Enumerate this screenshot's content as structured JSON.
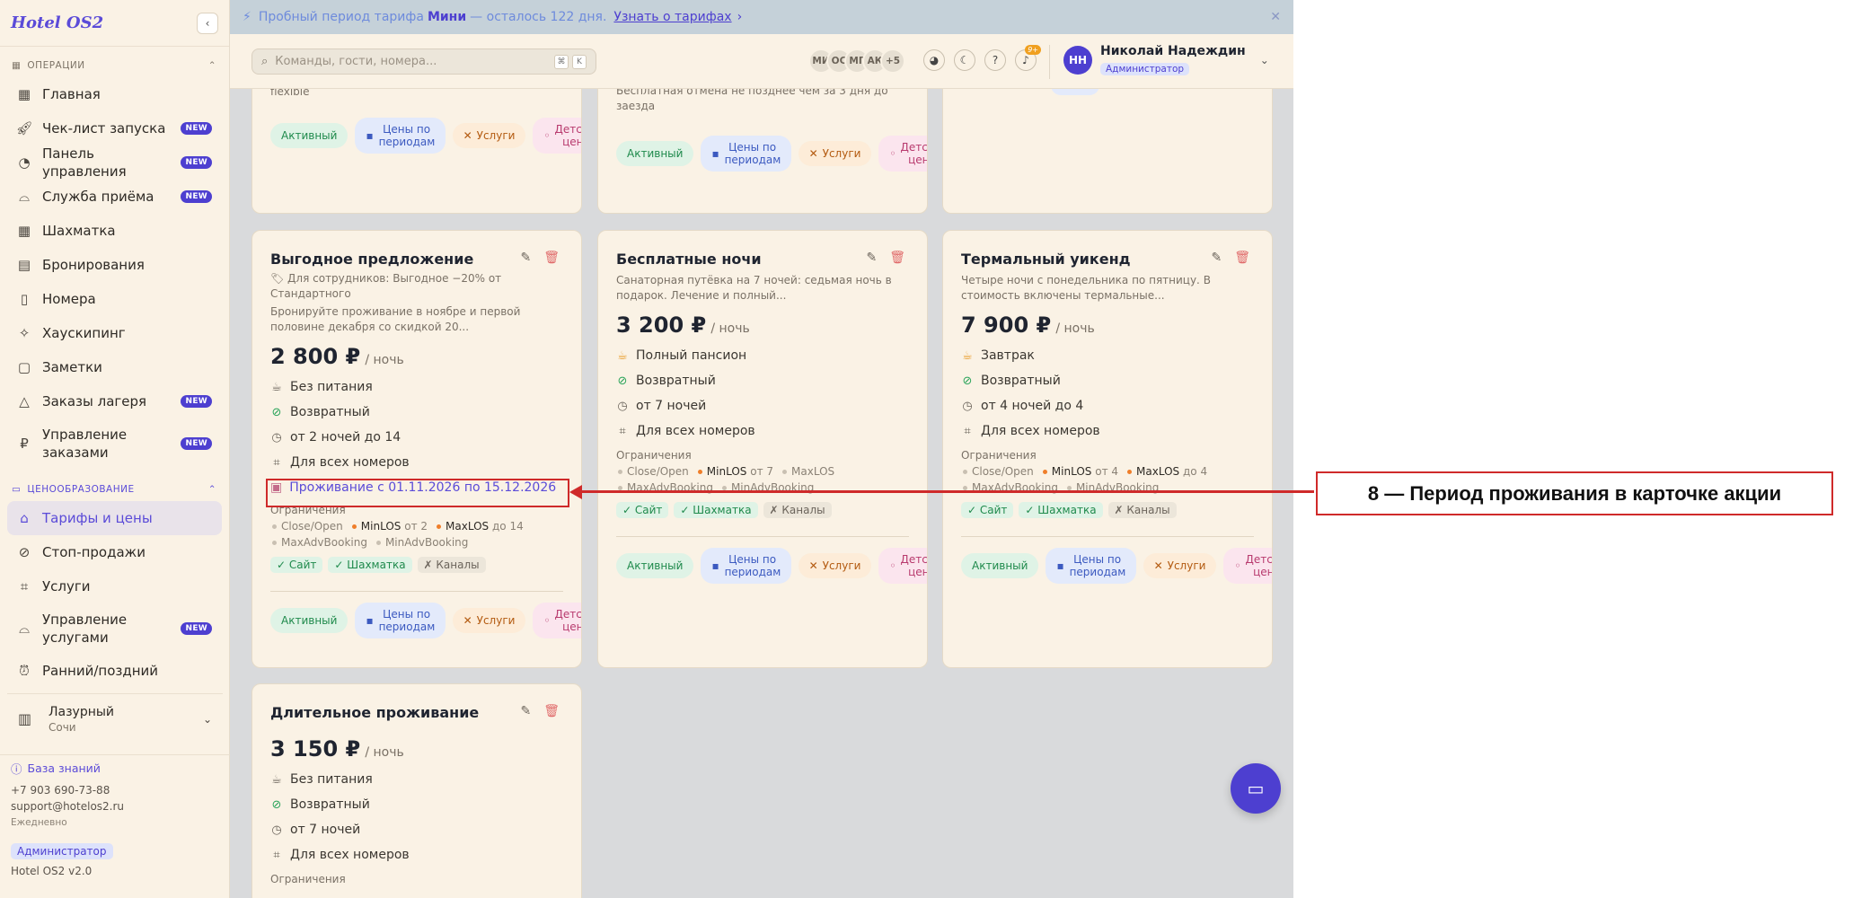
{
  "app": {
    "logo": "Hotel OS2"
  },
  "banner": {
    "text_before": "Пробный период тарифа",
    "plan": "Мини",
    "text_after": "— осталось 122 дня.",
    "link": "Узнать о тарифах"
  },
  "search": {
    "placeholder": "Команды, гости, номера...",
    "k1": "⌘",
    "k2": "K"
  },
  "team_avatars": [
    "МИ",
    "ОС",
    "МГ",
    "АК",
    "+5"
  ],
  "notifications": {
    "count": "9+"
  },
  "user": {
    "initials": "НН",
    "name": "Николай Надеждин",
    "role": "Администратор"
  },
  "sidebar": {
    "section_ops": "ОПЕРАЦИИ",
    "ops": [
      {
        "label": "Главная",
        "badge": ""
      },
      {
        "label": "Чек-лист запуска",
        "badge": "NEW"
      },
      {
        "label": "Панель управления",
        "badge": "NEW"
      },
      {
        "label": "Служба приёма",
        "badge": "NEW"
      },
      {
        "label": "Шахматка",
        "badge": ""
      },
      {
        "label": "Бронирования",
        "badge": ""
      },
      {
        "label": "Номера",
        "badge": ""
      },
      {
        "label": "Хаускипинг",
        "badge": ""
      },
      {
        "label": "Заметки",
        "badge": ""
      },
      {
        "label": "Заказы лагеря",
        "badge": "NEW"
      },
      {
        "label": "Управление заказами",
        "badge": "NEW"
      }
    ],
    "section_pricing": "ЦЕНООБРАЗОВАНИЕ",
    "pricing": [
      {
        "label": "Тарифы и цены",
        "badge": ""
      },
      {
        "label": "Стоп-продажи",
        "badge": ""
      },
      {
        "label": "Услуги",
        "badge": ""
      },
      {
        "label": "Управление услугами",
        "badge": "NEW"
      },
      {
        "label": "Ранний/поздний",
        "badge": ""
      }
    ],
    "hotel": {
      "name": "Лазурный",
      "city": "Сочи"
    },
    "footer": {
      "kb": "База знаний",
      "phone": "+7 903 690-73-88",
      "email": "support@hotelos2.ru",
      "schedule": "Ежедневно",
      "role": "Администратор",
      "version": "Hotel OS2 v2.0"
    }
  },
  "common": {
    "per_night": "/ ночь",
    "restrictions": "Ограничения",
    "close_open": "Close/Open",
    "minlos": "MinLOS",
    "maxlos": "MaxLOS",
    "maxadv": "MaxAdvBooking",
    "minadv": "MinAdvBooking",
    "site": "✓ Сайт",
    "chess": "✓ Шахматка",
    "channels": "✗ Каналы",
    "active": "Активный",
    "period_prices": "Цены по периодам",
    "services": "Услуги",
    "kids": "Детские цены",
    "all_rooms": "Для всех номеров",
    "refundable": "Возвратный"
  },
  "top_cards": {
    "card1_desc": "flexible",
    "card2_desc": "Бесплатная отмена не позднее чем за 3 дня до заезда"
  },
  "cards": [
    {
      "title": "Выгодное предложение",
      "staff_note": "🏷 Для сотрудников: Выгодное −20% от Стандартного",
      "desc": "Бронируйте проживание в ноябре и первой половине декабря со скидкой 20...",
      "price": "2 800 ₽",
      "meal": "Без питания",
      "stay": "от 2 ночей до 14",
      "period": "Проживание с 01.11.2026 по 15.12.2026",
      "minlos_v": "от 2",
      "maxlos_v": "до 14"
    },
    {
      "title": "Бесплатные ночи",
      "desc": "Санаторная путёвка на 7 ночей: седьмая ночь в подарок. Лечение и полный...",
      "price": "3 200 ₽",
      "meal": "Полный пансион",
      "stay": "от 7 ночей",
      "minlos_v": "от 7"
    },
    {
      "title": "Термальный уикенд",
      "desc": "Четыре ночи с понедельника по пятницу. В стоимость включены термальные...",
      "price": "7 900 ₽",
      "meal": "Завтрак",
      "stay": "от 4 ночей до 4",
      "minlos_v": "от 4",
      "maxlos_v": "до 4"
    },
    {
      "title": "Длительное проживание",
      "price": "3 150 ₽",
      "meal": "Без питания",
      "stay": "от 7 ночей"
    }
  ],
  "annotation": {
    "label": "8 — Период проживания в карточке акции"
  }
}
